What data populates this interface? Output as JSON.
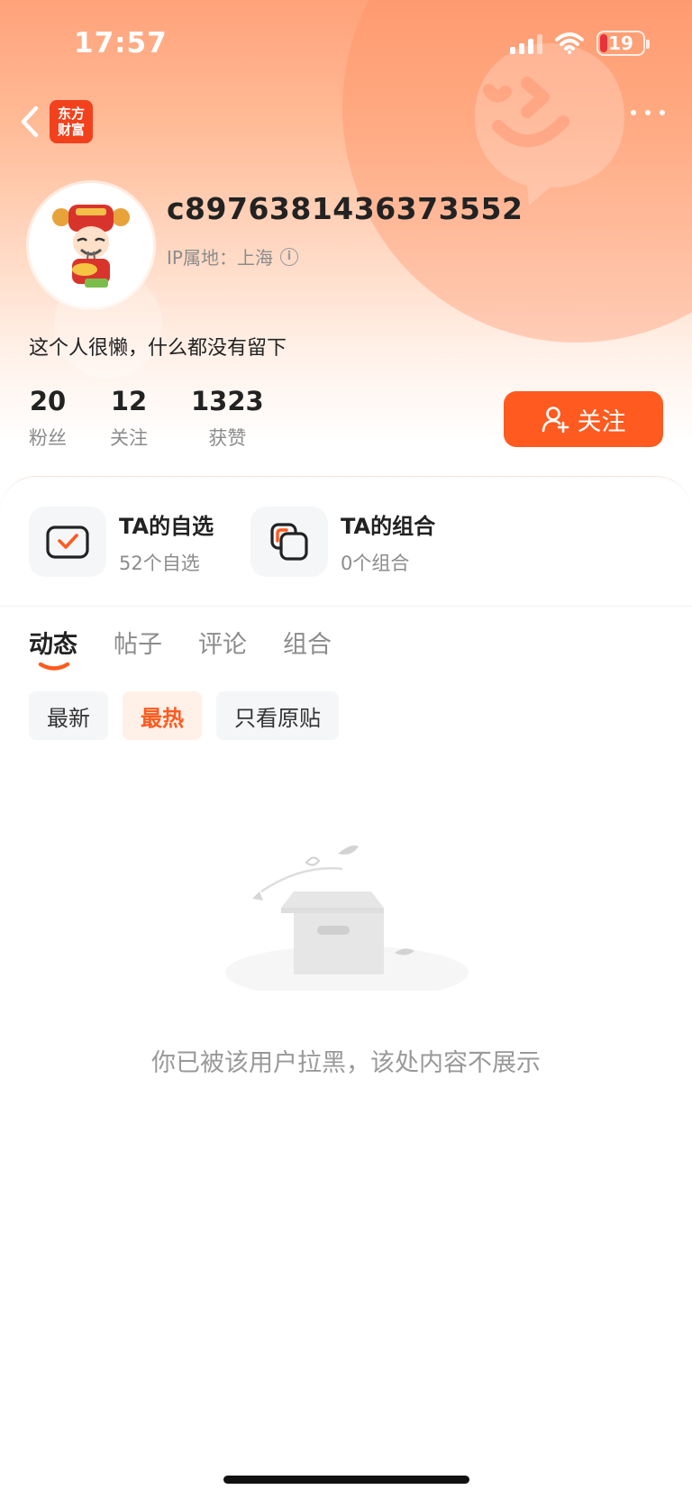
{
  "status_bar": {
    "time": "17:57",
    "battery": "19",
    "icons": [
      "cellular-signal-icon",
      "wifi-icon",
      "battery-icon"
    ]
  },
  "nav": {
    "back_icon": "chevron-left-icon",
    "logo_line1": "东方",
    "logo_line2": "财富",
    "more_icon": "more-dots-icon"
  },
  "profile": {
    "username": "c8976381436373552",
    "ip_label": "IP属地：上海",
    "bio": "这个人很懒，什么都没有留下",
    "stats": [
      {
        "value": "20",
        "label": "粉丝"
      },
      {
        "value": "12",
        "label": "关注"
      },
      {
        "value": "1323",
        "label": "获赞"
      }
    ],
    "follow_label": "关注"
  },
  "shortcuts": [
    {
      "title": "TA的自选",
      "subtitle": "52个自选",
      "icon": "watchlist-check-icon"
    },
    {
      "title": "TA的组合",
      "subtitle": "0个组合",
      "icon": "portfolio-icon"
    }
  ],
  "tabs": [
    {
      "label": "动态",
      "active": true
    },
    {
      "label": "帖子",
      "active": false
    },
    {
      "label": "评论",
      "active": false
    },
    {
      "label": "组合",
      "active": false
    }
  ],
  "filters": [
    {
      "label": "最新",
      "active": false
    },
    {
      "label": "最热",
      "active": true
    },
    {
      "label": "只看原贴",
      "active": false
    }
  ],
  "empty_state": {
    "message": "你已被该用户拉黑，该处内容不展示",
    "icon": "empty-box-icon"
  },
  "colors": {
    "accent": "#ff5a1f",
    "header_gradient_top": "#ffa27a",
    "muted_text": "#8c8c8c"
  }
}
